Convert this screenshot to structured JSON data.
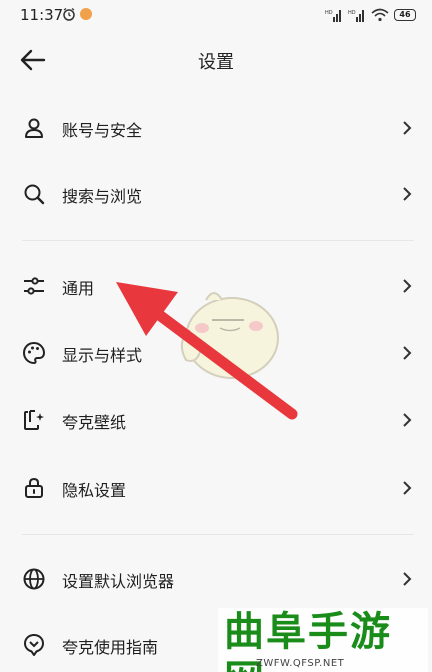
{
  "status_bar": {
    "time": "11:37",
    "battery": "46"
  },
  "header": {
    "title": "设置"
  },
  "settings": [
    {
      "label": "账号与安全",
      "icon": "person-icon"
    },
    {
      "label": "搜索与浏览",
      "icon": "search-icon"
    },
    {
      "label": "通用",
      "icon": "sliders-icon"
    },
    {
      "label": "显示与样式",
      "icon": "palette-icon"
    },
    {
      "label": "夸克壁纸",
      "icon": "wallpaper-icon"
    },
    {
      "label": "隐私设置",
      "icon": "lock-icon"
    },
    {
      "label": "设置默认浏览器",
      "icon": "globe-icon"
    },
    {
      "label": "夸克使用指南",
      "icon": "guide-icon"
    }
  ],
  "watermark": {
    "title": "曲阜手游网",
    "url": "ZWFW.QFSP.NET"
  },
  "colors": {
    "annotation_arrow": "#e8383d",
    "watermark_green": "#1a8c1a"
  }
}
